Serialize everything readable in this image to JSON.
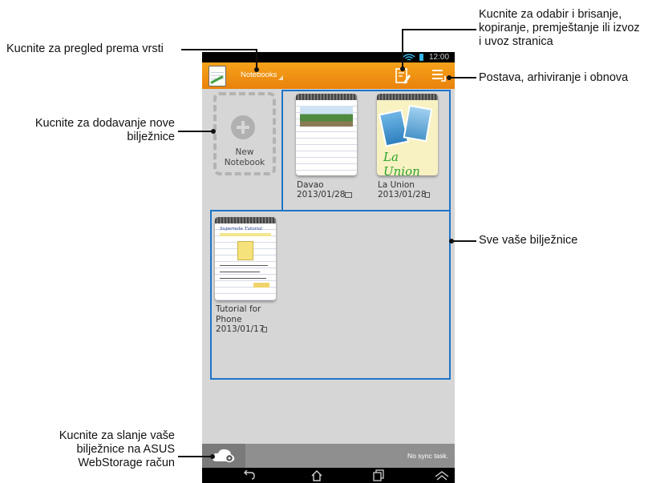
{
  "status_bar": {
    "time": "12:00"
  },
  "action_bar": {
    "category": "Notebooks"
  },
  "new_notebook": {
    "label_line1": "New",
    "label_line2": "Notebook"
  },
  "notebooks": [
    {
      "title": "Davao",
      "date": "2013/01/28"
    },
    {
      "title": "La Union",
      "date": "2013/01/28",
      "cover_text": "La Union"
    },
    {
      "title_line1": "Tutorial for",
      "title_line2": "Phone",
      "date": "2013/01/17",
      "cover_title": "Supernote Tutorial"
    }
  ],
  "bottom_bar": {
    "sync_status": "No sync task."
  },
  "callouts": {
    "view_by_type": "Kucnite za pregled prema vrsti",
    "add_notebook_line1": "Kucnite za dodavanje nove",
    "add_notebook_line2": "bilježnice",
    "upload_line1": "Kucnite za slanje vaše",
    "upload_line2": "bilježnice na ASUS",
    "upload_line3": "WebStorage račun",
    "select_line1": "Kucnite za odabir i brisanje,",
    "select_line2": "kopiranje, premještanje ili izvoz",
    "select_line3": "i uvoz stranica",
    "settings": "Postava, arhiviranje i obnova",
    "all_notebooks": "Sve vaše bilježnice"
  },
  "colors": {
    "accent_orange": "#ef8f12",
    "highlight_blue": "#1e74c9"
  },
  "icons": [
    "app-icon",
    "dropdown-arrow-icon",
    "edit-select-icon",
    "menu-icon",
    "cloud-settings-icon",
    "back-icon",
    "home-icon",
    "recent-apps-icon",
    "up-icon",
    "wifi-icon",
    "battery-icon"
  ]
}
